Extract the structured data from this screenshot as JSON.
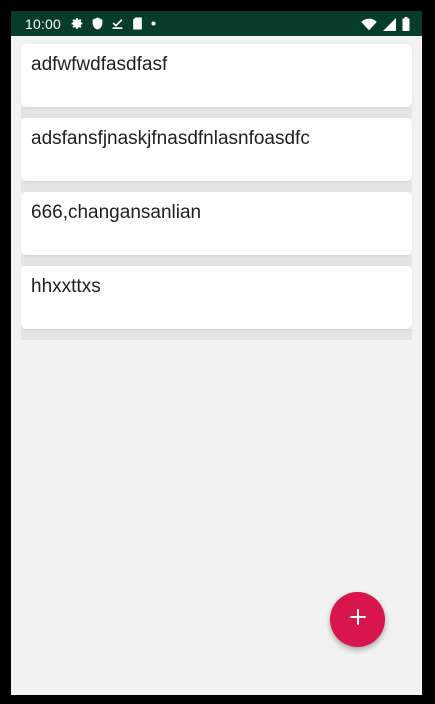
{
  "status_bar": {
    "time": "10:00",
    "left_icons": [
      "gear-icon",
      "shield-icon",
      "download-done-icon",
      "sd-card-icon",
      "dot-icon"
    ],
    "right_icons": [
      "wifi-icon",
      "signal-icon",
      "battery-icon"
    ],
    "background": "#073b2a"
  },
  "items": [
    {
      "title": "adfwfwdfasdfasf"
    },
    {
      "title": "adsfansfjnaskjfnasdfnlasnfoasdfc"
    },
    {
      "title": "666,changansanlian"
    },
    {
      "title": "hhxxttxs"
    }
  ],
  "fab": {
    "icon": "plus-icon",
    "color": "#d8164c"
  }
}
